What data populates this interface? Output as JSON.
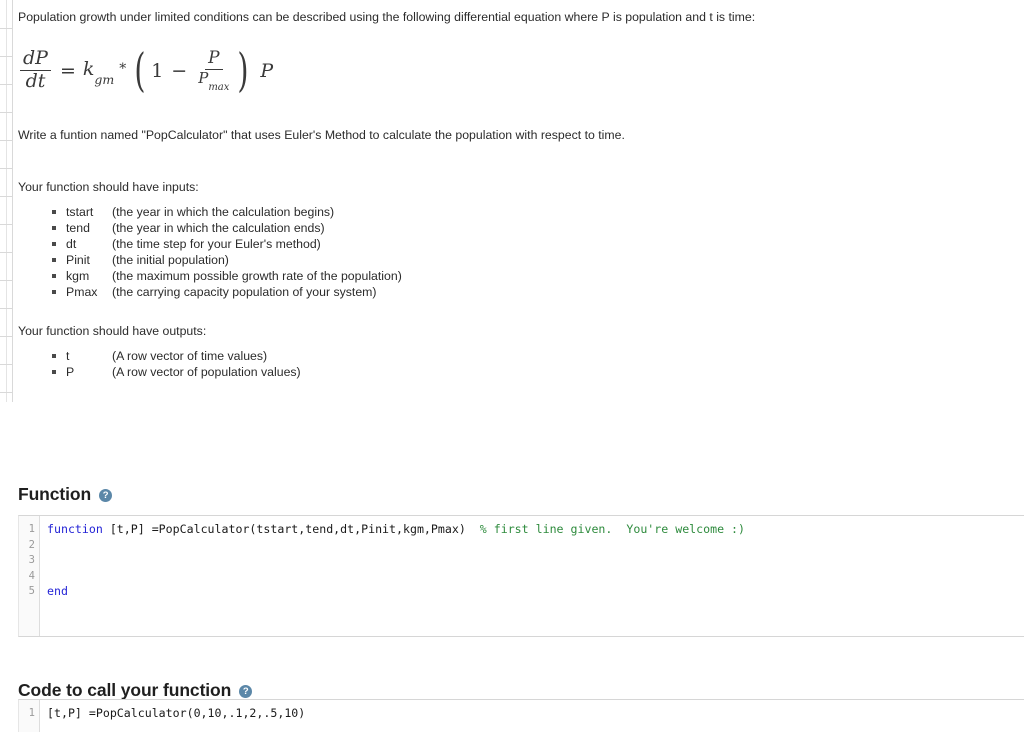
{
  "intro": {
    "paragraph": "Population growth under limited conditions can be described using the following differential equation where P is population and t is time:"
  },
  "equation": {
    "description": "dP/dt = k_gm * (1 - P/Pmax) P",
    "lhs_num": "dP",
    "lhs_den": "dt",
    "equals": "=",
    "k": "k",
    "k_sub": "gm",
    "star": "*",
    "paren_open": "(",
    "one": "1",
    "minus": "−",
    "frac2_num": "P",
    "frac2_den": "P",
    "frac2_den_sub": "max",
    "paren_close": ")",
    "trailing": "P"
  },
  "task": {
    "write_instruction": "Write a funtion named \"PopCalculator\" that uses Euler's Method to calculate the population with respect to time.",
    "inputs_label": "Your function should have inputs:",
    "outputs_label": "Your function should have outputs:"
  },
  "inputs": [
    {
      "name": "tstart",
      "desc": "(the year in which the calculation begins)"
    },
    {
      "name": "tend",
      "desc": "(the year in which the calculation ends)"
    },
    {
      "name": "dt",
      "desc": "(the time step for your Euler's method)"
    },
    {
      "name": "Pinit",
      "desc": "(the initial population)"
    },
    {
      "name": "kgm",
      "desc": "(the maximum possible growth rate of the population)"
    },
    {
      "name": "Pmax",
      "desc": "(the carrying capacity population of your system)"
    }
  ],
  "outputs": [
    {
      "name": "t",
      "desc": "(A row vector of time values)"
    },
    {
      "name": "P",
      "desc": "(A row vector of population values)"
    }
  ],
  "function_section": {
    "heading": "Function",
    "help": "?",
    "line_numbers": [
      "1",
      "2",
      "3",
      "4",
      "5"
    ],
    "code": {
      "line1_kw": "function",
      "line1_rest": " [t,P] =PopCalculator(tstart,tend,dt,Pinit,kgm,Pmax)",
      "line1_comment": "  % first line given.  You're welcome :)",
      "line2": "",
      "line3": "",
      "line4": "",
      "line5_kw": "end"
    }
  },
  "call_section": {
    "heading": "Code to call your function",
    "help": "?",
    "line_numbers": [
      "1"
    ],
    "code": {
      "line1": "[t,P] =PopCalculator(0,10,.1,2,.5,10)"
    }
  },
  "colors": {
    "keyword": "#2424d6",
    "comment": "#2e8b3d",
    "help_icon": "#5b87a8",
    "text": "#2b2b2b",
    "border": "#d6d6d6"
  }
}
